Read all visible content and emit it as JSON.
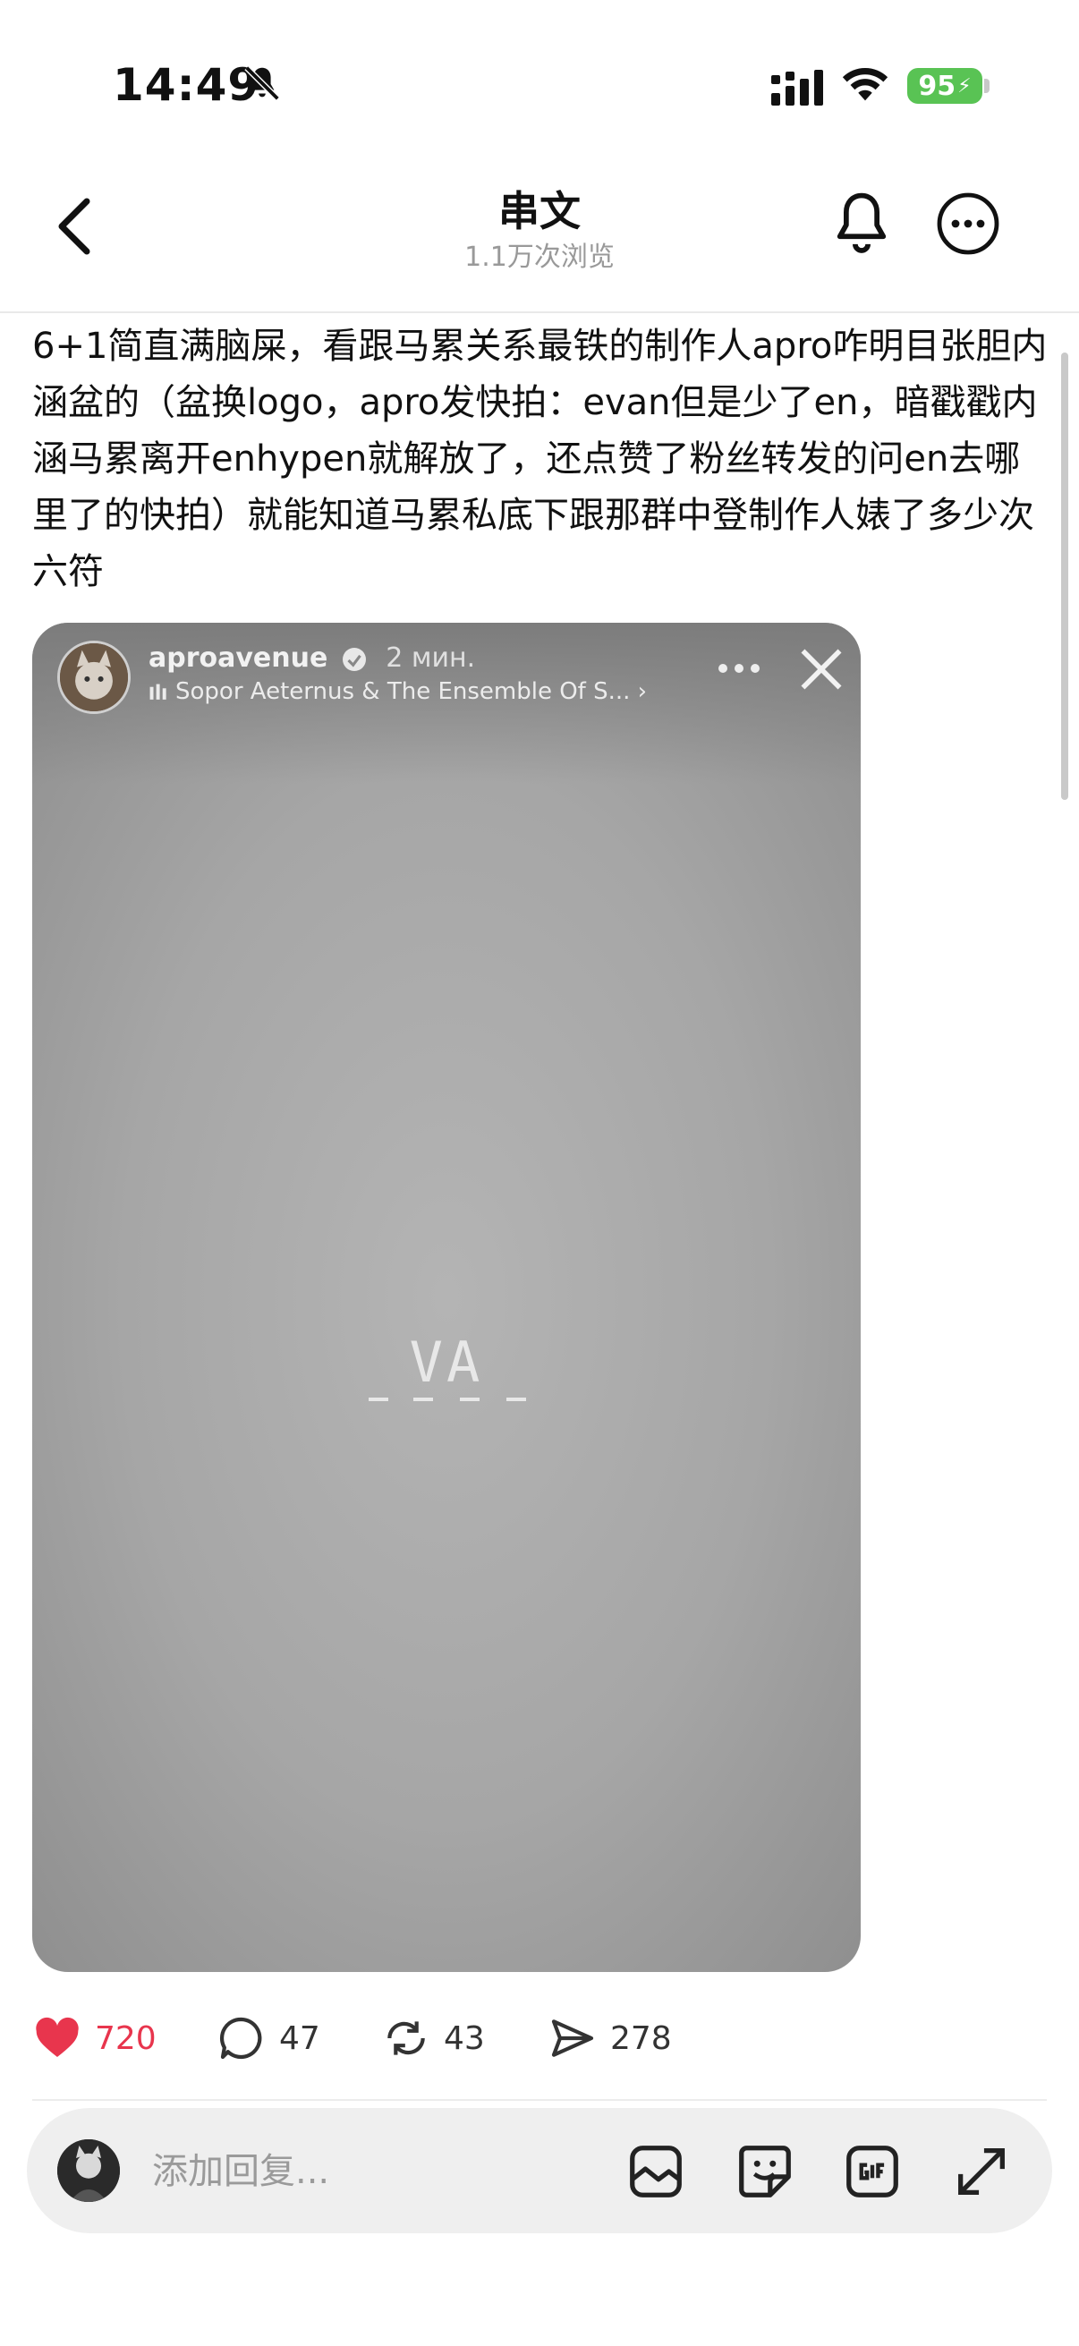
{
  "status_bar": {
    "time": "14:49",
    "battery": "95"
  },
  "nav": {
    "title": "串文",
    "views": "1.1万次浏览"
  },
  "post": {
    "text": "6+1简直满脑屎，看跟马累关系最铁的制作人apro咋明目张胆内涵盆的（盆换logo，apro发快拍：evan但是少了en，暗戳戳内涵马累离开enhypen就解放了，还点赞了粉丝转发的问en去哪里了的快拍）就能知道马累私底下跟那群中登制作人婊了多少次六符",
    "story": {
      "username": "aproavenue",
      "time": "2 мин.",
      "music": "Sopor Aeternus & The Ensemble Of S...",
      "overlay_text": "VA"
    }
  },
  "actions": {
    "likes": "720",
    "comments": "47",
    "reposts": "43",
    "shares": "278"
  },
  "reply_bar": {
    "placeholder": "添加回复..."
  },
  "colors": {
    "like_red": "#e8354d",
    "battery_green": "#59c354"
  },
  "icons": [
    "bell-slash-icon",
    "signal-icon",
    "wifi-icon",
    "battery-icon",
    "back-chevron-icon",
    "bell-icon",
    "more-icon",
    "verified-icon",
    "music-bars-icon",
    "dots-icon",
    "close-icon",
    "heart-icon",
    "comment-icon",
    "repost-icon",
    "send-icon",
    "image-icon",
    "sticker-icon",
    "gif-icon",
    "expand-icon"
  ]
}
